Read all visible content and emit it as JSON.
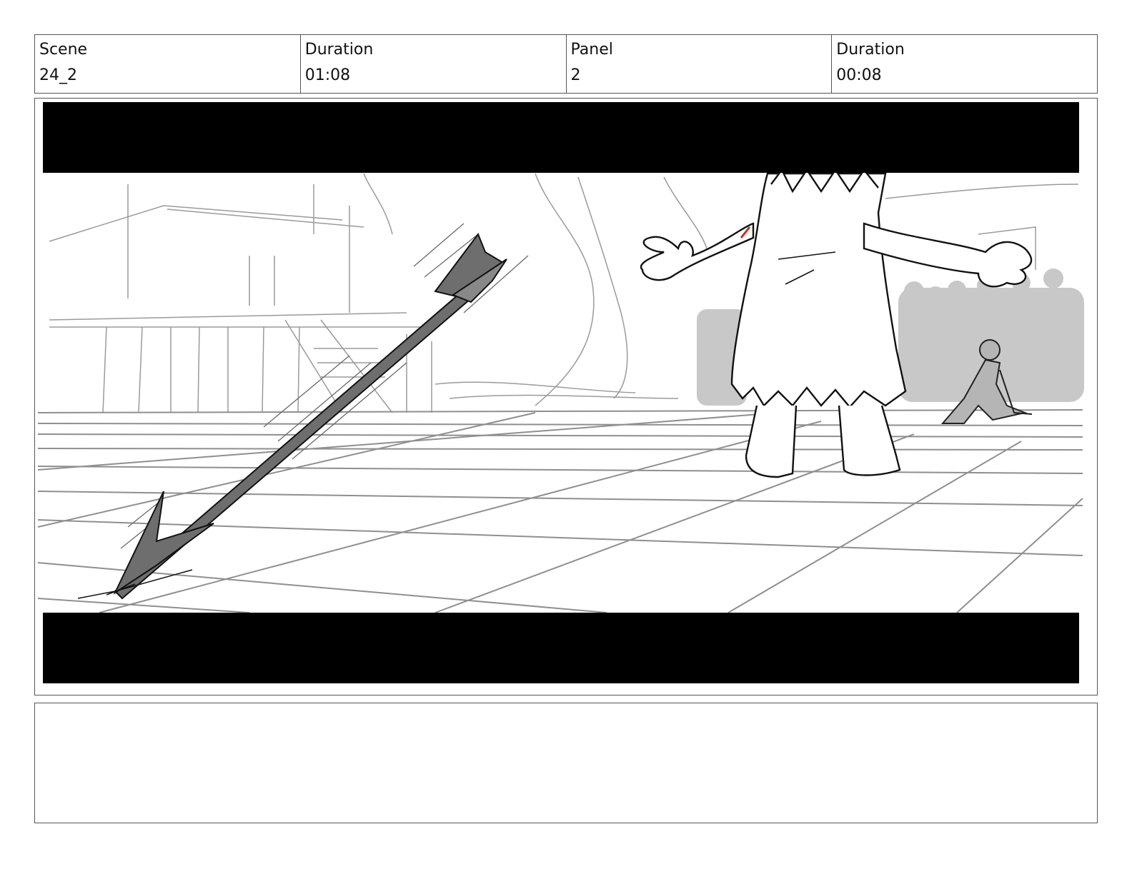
{
  "header": {
    "scene_label": "Scene",
    "scene_value": "24_2",
    "scene_duration_label": "Duration",
    "scene_duration_value": "01:08",
    "panel_label": "Panel",
    "panel_value": "2",
    "panel_duration_label": "Duration",
    "panel_duration_value": "00:08"
  },
  "notes": {
    "text": ""
  }
}
